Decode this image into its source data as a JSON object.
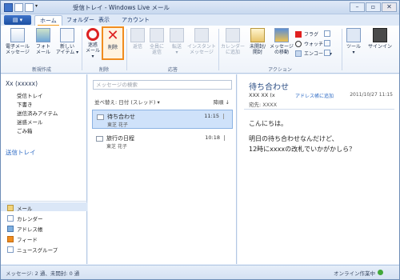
{
  "window": {
    "title": "受信トレイ - Windows Live メール"
  },
  "tabs": {
    "app_label": "▤ ▾",
    "items": [
      "ホーム",
      "フォルダー",
      "表示",
      "アカウント"
    ]
  },
  "ribbon": {
    "new_email": "電子メール\nメッセージ",
    "new_photo": "フォト\nメール",
    "new_items": "新しい\nアイテム ▾",
    "junk": "迷惑\nメール ▾",
    "delete": "削除",
    "reply": "返信",
    "reply_all": "全員に\n返信",
    "forward": "転送\n▾",
    "im": "インスタント\nメッセージ",
    "add_calendar": "カレンダー\nに追加",
    "unread_read": "未開封/\n開封",
    "move": "メッセージ\nの移動",
    "flag": "フラグ",
    "watch": "ウォッチ",
    "encode": "エンコード ▾",
    "tools": "ツール\n▾",
    "signin": "サインイン",
    "groups": {
      "new": "新規作成",
      "delete": "削除",
      "respond": "応答",
      "actions": "アクション"
    }
  },
  "left": {
    "account": "Xx (xxxxx)",
    "folders": [
      "受信トレイ",
      "下書き",
      "送信済みアイテム",
      "迷惑メール",
      "ごみ箱"
    ],
    "outbox": "送信トレイ",
    "nav": [
      "メール",
      "カレンダー",
      "アドレス帳",
      "フィード",
      "ニュースグループ"
    ]
  },
  "list": {
    "search_placeholder": "メッセージの検索",
    "sort": "並べ替え: 日付 (スレッド) ▾",
    "order": "降順 ↓",
    "messages": [
      {
        "subject": "待ち合わせ",
        "from": "東芝 花子",
        "time": "11:15"
      },
      {
        "subject": "旅行の日程",
        "from": "東芝 花子",
        "time": "10:18"
      }
    ]
  },
  "reading": {
    "subject": "待ち合わせ",
    "from": "XXX XX (x",
    "add_contact": "アドレス帳に追加",
    "date": "2011/10/27 11:15",
    "to": "宛先: XXXX",
    "body": [
      "こんにちは。",
      "明日の待ち合わせなんだけど、",
      "12時にxxxxの改札でいかがかしら？"
    ]
  },
  "status": {
    "left": "メッセージ: 2 通、未開封: 0 通",
    "right": "オンライン作業中"
  },
  "colors": {
    "accent": "#f08c1e",
    "selected": "#cfe2fa",
    "link": "#2e6bc5"
  }
}
